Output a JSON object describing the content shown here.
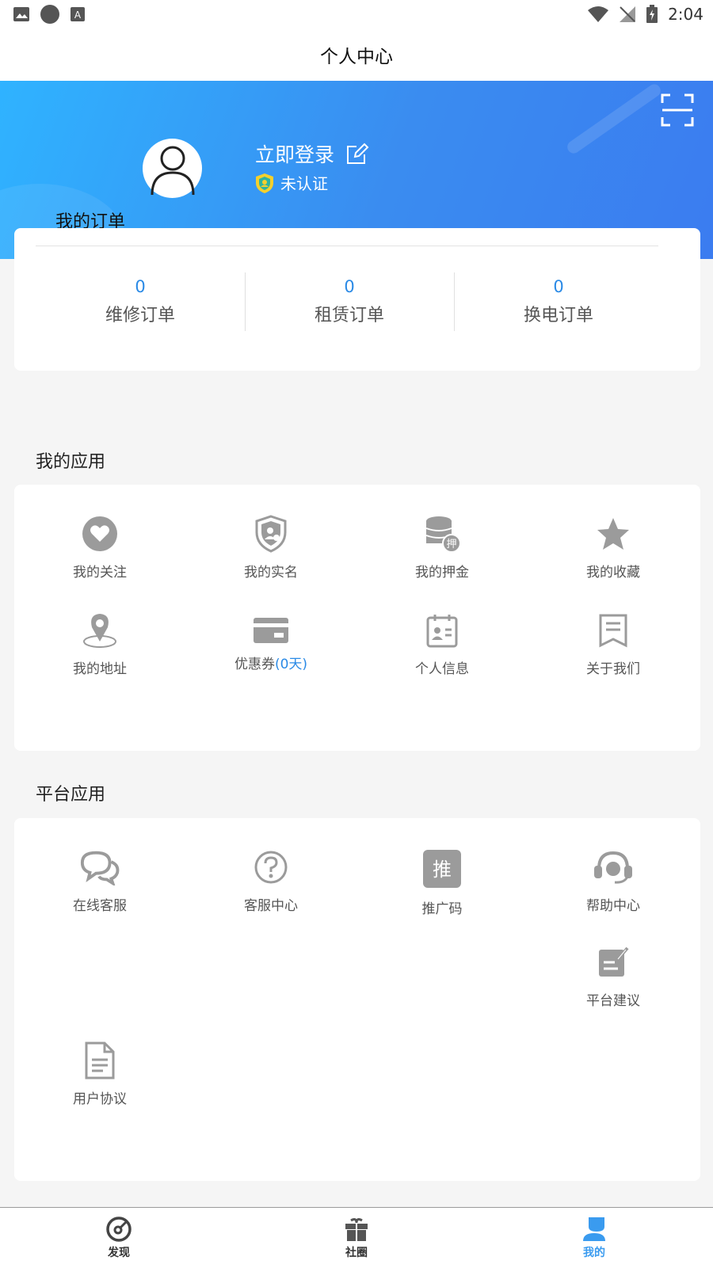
{
  "status_bar": {
    "time": "2:04"
  },
  "header": {
    "title": "个人中心"
  },
  "profile": {
    "login_label": "立即登录",
    "verify_status": "未认证"
  },
  "orders": {
    "heading": "我的订单",
    "items": [
      {
        "count": "0",
        "label": "维修订单"
      },
      {
        "count": "0",
        "label": "租赁订单"
      },
      {
        "count": "0",
        "label": "换电订单"
      }
    ]
  },
  "my_apps": {
    "heading": "我的应用",
    "items": [
      {
        "label": "我的关注",
        "icon": "heart-icon"
      },
      {
        "label": "我的实名",
        "icon": "shield-user-icon"
      },
      {
        "label": "我的押金",
        "icon": "deposit-coins-icon"
      },
      {
        "label": "我的收藏",
        "icon": "star-icon"
      },
      {
        "label": "我的地址",
        "icon": "location-pin-icon"
      },
      {
        "label": "优惠券",
        "suffix": "(0天)",
        "icon": "coupon-card-icon"
      },
      {
        "label": "个人信息",
        "icon": "id-card-icon"
      },
      {
        "label": "关于我们",
        "icon": "about-bookmark-icon"
      }
    ]
  },
  "platform_apps": {
    "heading": "平台应用",
    "items": [
      {
        "label": "在线客服",
        "icon": "chat-bubbles-icon"
      },
      {
        "label": "客服中心",
        "icon": "question-icon"
      },
      {
        "label": "推广码",
        "icon": "promo-code-icon",
        "glyph": "推"
      },
      {
        "label": "帮助中心",
        "icon": "headset-icon"
      },
      {
        "label": "平台建议",
        "icon": "suggestion-edit-icon"
      },
      {
        "label": "用户协议",
        "icon": "document-icon"
      }
    ]
  },
  "tabs": [
    {
      "label": "发现",
      "icon": "discover-icon"
    },
    {
      "label": "社圈",
      "icon": "gift-icon"
    },
    {
      "label": "我的",
      "icon": "user-icon",
      "active": true
    }
  ],
  "colors": {
    "accent": "#2a8ae6",
    "hero_start": "#2fb3ff",
    "hero_end": "#3b7cf0",
    "icon_gray": "#9b9b9b"
  }
}
